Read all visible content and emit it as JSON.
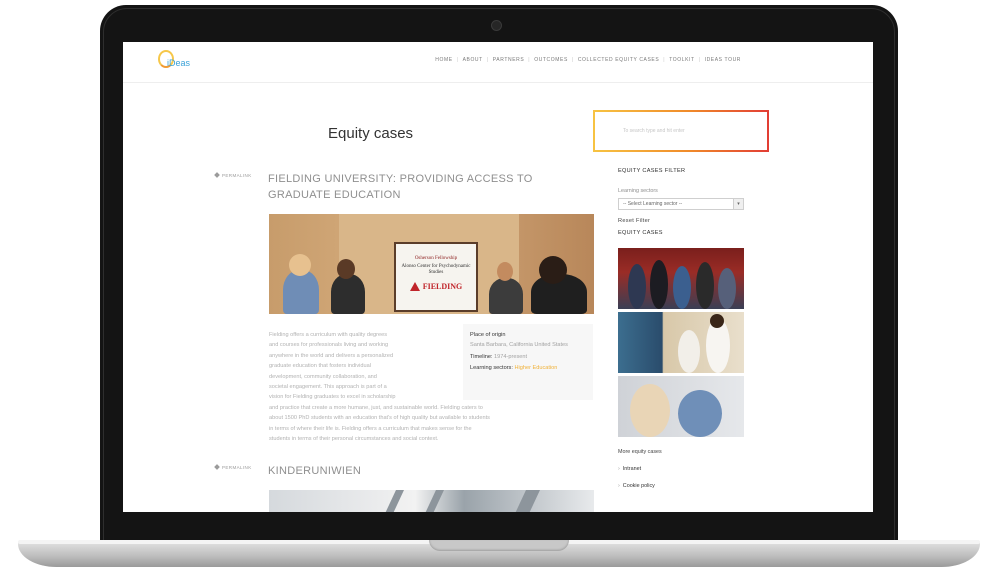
{
  "site": {
    "logo_text": "iDeas"
  },
  "nav": [
    "HOME",
    "ABOUT",
    "PARTNERS",
    "OUTCOMES",
    "COLLECTED EQUITY CASES",
    "TOOLKIT",
    "IDEAS TOUR"
  ],
  "page": {
    "title": "Equity cases"
  },
  "search": {
    "placeholder": "To search type and hit enter"
  },
  "articles": [
    {
      "permalink": "PERMALINK",
      "title": "FIELDING UNIVERSITY: PROVIDING ACCESS TO GRADUATE EDUCATION",
      "photo_board": {
        "line1": "Osherson Fellowship",
        "line2": "Alonso Center for Psychodynamic Studies",
        "brand": "FIELDING"
      },
      "body_narrow": [
        "Fielding offers a curriculum with quality degrees",
        "and courses for professionals living and working",
        "anywhere in the world and delivers a personalized",
        "graduate education that fosters individual",
        "development, community collaboration, and",
        "societal engagement. This approach is part of a",
        "vision for Fielding graduates to excel in scholarship"
      ],
      "body_wide": [
        "and practice that create a more humane, just, and sustainable world. Fielding caters to",
        "about 1500 PhD students with an education that's of high quality but available to students",
        "in terms of where their life is. Fielding offers a curriculum that makes sense for the",
        "students in terms of their personal circumstances and social context."
      ],
      "info": {
        "origin_label": "Place of origin",
        "origin_value": "Santa Barbara, California United States",
        "timeline_label": "Timeline:",
        "timeline_value": "1974-present",
        "sectors_label": "Learning sectors:",
        "sectors_value": "Higher Education"
      }
    },
    {
      "permalink": "PERMALINK",
      "title": "KINDERUNIWIEN"
    }
  ],
  "sidebar": {
    "filter_heading": "EQUITY CASES FILTER",
    "sectors_label": "Learning sectors",
    "select_value": "-- Select Learning sector --",
    "reset": "Reset Filter",
    "cases_heading": "EQUITY CASES",
    "more_heading": "More equity cases",
    "links": [
      "Intranet",
      "Cookie policy"
    ]
  },
  "colors": {
    "accent": "#f0b23a",
    "search_border_start": "#f7c342",
    "search_border_end": "#e23e34",
    "logo": "#3aa2d8"
  }
}
